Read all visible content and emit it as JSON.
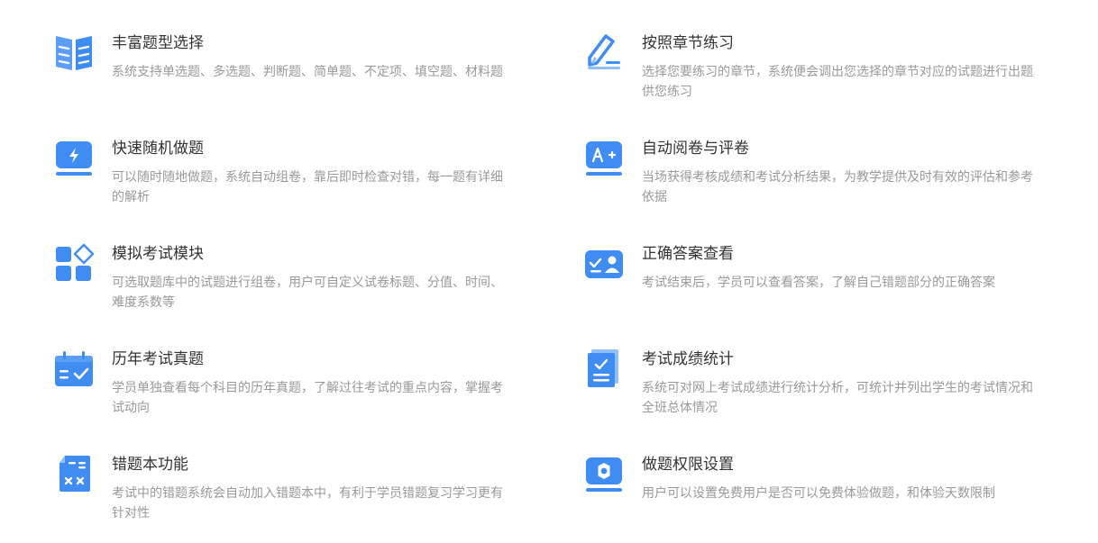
{
  "features": [
    {
      "title": "丰富题型选择",
      "description": "系统支持单选题、多选题、判断题、简单题、不定项、填空题、材料题",
      "icon": "book-icon"
    },
    {
      "title": "按照章节练习",
      "description": "选择您要练习的章节，系统便会调出您选择的章节对应的试题进行出题供您练习",
      "icon": "pen-icon"
    },
    {
      "title": "快速随机做题",
      "description": "可以随时随地做题，系统自动组卷，靠后即时检查对错，每一题有详细的解析",
      "icon": "lightning-monitor-icon"
    },
    {
      "title": "自动阅卷与评卷",
      "description": "当场获得考核成绩和考试分析结果，为教学提供及时有效的评估和参考依据",
      "icon": "grade-a-plus-icon"
    },
    {
      "title": "模拟考试模块",
      "description": "可选取题库中的试题进行组卷，用户可自定义试卷标题、分值、时间、难度系数等",
      "icon": "modules-icon"
    },
    {
      "title": "正确答案查看",
      "description": "考试结束后，学员可以查看答案，了解自己错题部分的正确答案",
      "icon": "answer-card-icon"
    },
    {
      "title": "历年考试真题",
      "description": "学员单独查看每个科目的历年真题，了解过往考试的重点内容，掌握考试动向",
      "icon": "calendar-check-icon"
    },
    {
      "title": "考试成绩统计",
      "description": "系统可对网上考试成绩进行统计分析，可统计并列出学生的考试情况和全班总体情况",
      "icon": "checklist-document-icon"
    },
    {
      "title": "错题本功能",
      "description": "考试中的错题系统会自动加入错题本中，有利于学员错题复习学习更有针对性",
      "icon": "calculator-icon"
    },
    {
      "title": "做题权限设置",
      "description": "用户可以设置免费用户是否可以免费体验做题，和体验天数限制",
      "icon": "settings-gear-icon"
    }
  ],
  "colors": {
    "icon_blue": "#3f8cf3",
    "icon_light": "#8ec0fb",
    "title": "#333333",
    "description": "#999999"
  }
}
